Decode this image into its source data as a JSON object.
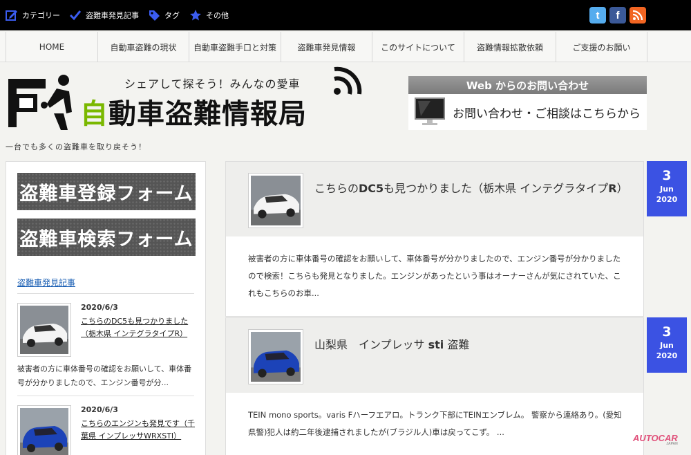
{
  "topnav": [
    {
      "label": "カテゴリー",
      "icon": "edit-icon"
    },
    {
      "label": "盗難車発見記事",
      "icon": "check-icon"
    },
    {
      "label": "タグ",
      "icon": "tag-icon"
    },
    {
      "label": "その他",
      "icon": "star-icon"
    }
  ],
  "social": [
    {
      "label": "t",
      "icon": "twitter-icon",
      "color": "#55acee"
    },
    {
      "label": "f",
      "icon": "facebook-icon",
      "color": "#3b5998"
    },
    {
      "label": "rss",
      "icon": "rss-icon",
      "color": "#f26522"
    }
  ],
  "mainnav": [
    "HOME",
    "自動車盗難の現状",
    "自動車盗難手口と対策",
    "盗難車発見情報",
    "このサイトについて",
    "盗難情報拡散依頼",
    "ご支援のお願い"
  ],
  "header": {
    "tagline": "シェアして探そう！みんなの愛車",
    "title_green": "自",
    "title_rest": "動車盗難情報局",
    "subtagline": "一台でも多くの盗難車を取り戻そう！"
  },
  "contact": {
    "heading": "Web からのお問い合わせ",
    "text": "お問い合わせ・ご相談はこちらから"
  },
  "sidebar": {
    "banner1": "盗難車登録フォーム",
    "banner2": "盗難車検索フォーム",
    "heading": "盗難車発見記事",
    "items": [
      {
        "date": "2020/6/3",
        "title": "こちらのDC5も見つかりました（栃木県 インテグラタイプR）",
        "excerpt": "被害者の方に車体番号の確認をお願いして、車体番号が分かりましたので、エンジン番号が分..."
      },
      {
        "date": "2020/6/3",
        "title": "こちらのエンジンも発見です（千葉県 インプレッサWRXSTI）",
        "excerpt": ""
      }
    ]
  },
  "posts": [
    {
      "title_part1": "こちらの",
      "title_bold1": "DC5",
      "title_part2": "も見つかりました（栃木県 インテグラタイプ",
      "title_bold2": "R",
      "title_part3": "）",
      "excerpt": "被害者の方に車体番号の確認をお願いして、車体番号が分かりましたので、エンジン番号が分かりましたので検索！こちらも発見となりました。エンジンがあったという事はオーナーさんが気にされていた、これもこちらのお車...",
      "day": "3",
      "month": "Jun",
      "year": "2020"
    },
    {
      "title_part1": "山梨県　インプレッサ ",
      "title_bold1": "sti",
      "title_part2": " 盗難",
      "title_bold2": "",
      "title_part3": "",
      "excerpt": "TEIN mono sports。varis Fハーフエアロ。トランク下部にTEINエンブレム。 警察から連絡あり。(愛知県警)犯人は約二年後逮捕されましたが(ブラジル人)車は戻ってこず。 ...",
      "day": "3",
      "month": "Jun",
      "year": "2020"
    }
  ],
  "watermark": {
    "brand": "AUTOCAR",
    "sub": "JAPAN"
  },
  "colors": {
    "accent": "#3b52e3",
    "brand_green": "#7ab800",
    "link": "#1a5fb4"
  }
}
